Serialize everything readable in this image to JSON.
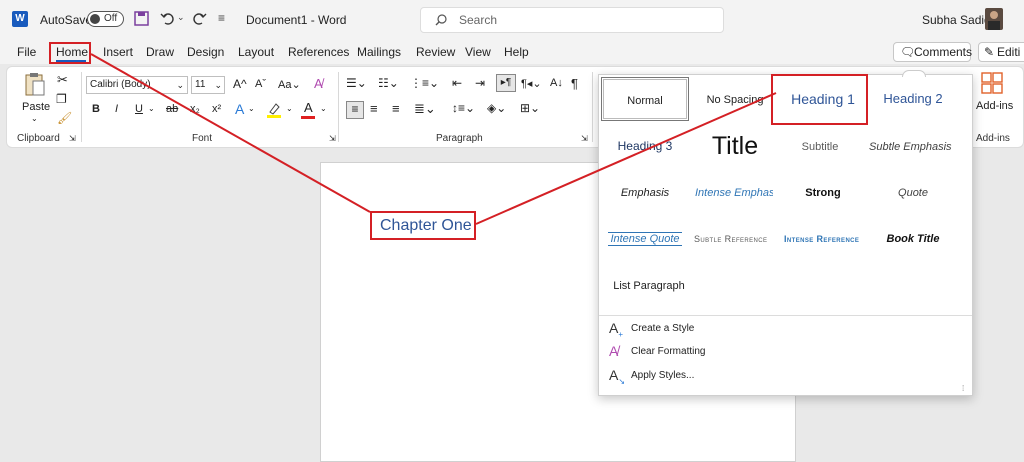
{
  "titlebar": {
    "app_icon": "W",
    "autosave_label": "AutoSave",
    "autosave_state": "Off",
    "doc_title": "Document1 - Word",
    "search_placeholder": "Search",
    "user_name": "Subha Sadiq"
  },
  "tabs": [
    "File",
    "Home",
    "Insert",
    "Draw",
    "Design",
    "Layout",
    "References",
    "Mailings",
    "Review",
    "View",
    "Help"
  ],
  "tab_buttons": {
    "comments": "Comments",
    "editing": "Editi"
  },
  "ribbon": {
    "paste_label": "Paste",
    "clipboard_label": "Clipboard",
    "font_name": "Calibri (Body)",
    "font_size": "11",
    "font_label": "Font",
    "paragraph_label": "Paragraph",
    "addins_label": "Add-ins",
    "addins_group_label": "Add-ins",
    "format_buttons": [
      "B",
      "I",
      "U",
      "ab",
      "x₂",
      "x²"
    ]
  },
  "document": {
    "heading_text": "Chapter One"
  },
  "styles_gallery": {
    "styles": [
      [
        "Normal",
        "No Spacing",
        "Heading 1",
        "Heading 2"
      ],
      [
        "Heading 3",
        "Title",
        "Subtitle",
        "Subtle Emphasis"
      ],
      [
        "Emphasis",
        "Intense Emphasis",
        "Strong",
        "Quote"
      ],
      [
        "Intense Quote",
        "Subtle Reference",
        "Intense Reference",
        "Book Title"
      ],
      [
        "List Paragraph"
      ]
    ],
    "commands": [
      "Create a Style",
      "Clear Formatting",
      "Apply Styles..."
    ]
  },
  "colors": {
    "accent_blue": "#2f5597",
    "annotation_red": "#d42025",
    "word_blue": "#185abd"
  }
}
